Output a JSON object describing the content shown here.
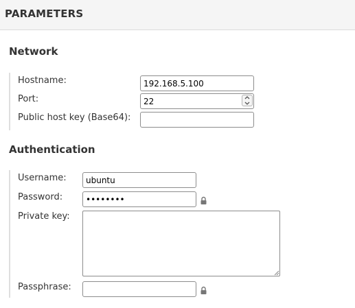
{
  "header": {
    "title": "PARAMETERS"
  },
  "network": {
    "title": "Network",
    "hostname": {
      "label": "Hostname:",
      "value": "192.168.5.100"
    },
    "port": {
      "label": "Port:",
      "value": "22"
    },
    "public_host_key": {
      "label": "Public host key (Base64):",
      "value": ""
    }
  },
  "authentication": {
    "title": "Authentication",
    "username": {
      "label": "Username:",
      "value": "ubuntu"
    },
    "password": {
      "label": "Password:",
      "value": "********"
    },
    "private_key": {
      "label": "Private key:",
      "value": ""
    },
    "passphrase": {
      "label": "Passphrase:",
      "value": ""
    }
  },
  "icons": {
    "password_lock": "lock-icon",
    "passphrase_lock": "lock-icon",
    "port_spinner": "spinner-arrows-icon",
    "resize_grip": "resize-grip-icon"
  },
  "colors": {
    "header_bg": "#f5f5f5",
    "field_border": "#8c8c8c",
    "section_rule": "#dedede",
    "text": "#333333"
  }
}
